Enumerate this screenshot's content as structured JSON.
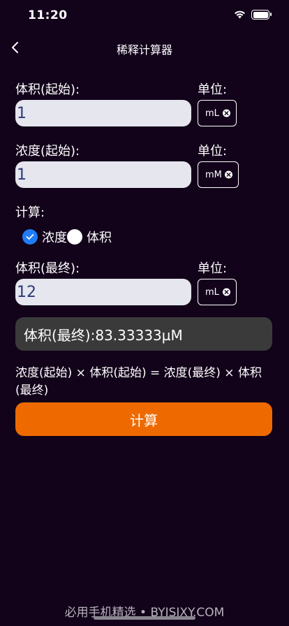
{
  "status_bar": {
    "time": "11:20"
  },
  "nav": {
    "title": "稀释计算器"
  },
  "form": {
    "initial_volume": {
      "label": "体积(起始):",
      "value": "1",
      "unit_label": "单位:",
      "unit": "mL"
    },
    "initial_concentration": {
      "label": "浓度(起始):",
      "value": "1",
      "unit_label": "单位:",
      "unit": "mM"
    },
    "calculate": {
      "label": "计算:",
      "options": [
        {
          "label": "浓度",
          "checked": true
        },
        {
          "label": "体积",
          "checked": false
        }
      ]
    },
    "final_volume": {
      "label": "体积(最终):",
      "value": "12",
      "unit_label": "单位:",
      "unit": "mL"
    }
  },
  "result": {
    "text": "体积(最终):83.33333µM"
  },
  "formula": {
    "text": "浓度(起始) × 体积(起始) = 浓度(最终) × 体积(最终)"
  },
  "button": {
    "label": "计算"
  },
  "watermark": {
    "text": "必用手机精选 • BYJSJXY.COM"
  },
  "colors": {
    "background": "#12021a",
    "accent": "#ee6a00",
    "radio_checked": "#1f7cf6"
  }
}
